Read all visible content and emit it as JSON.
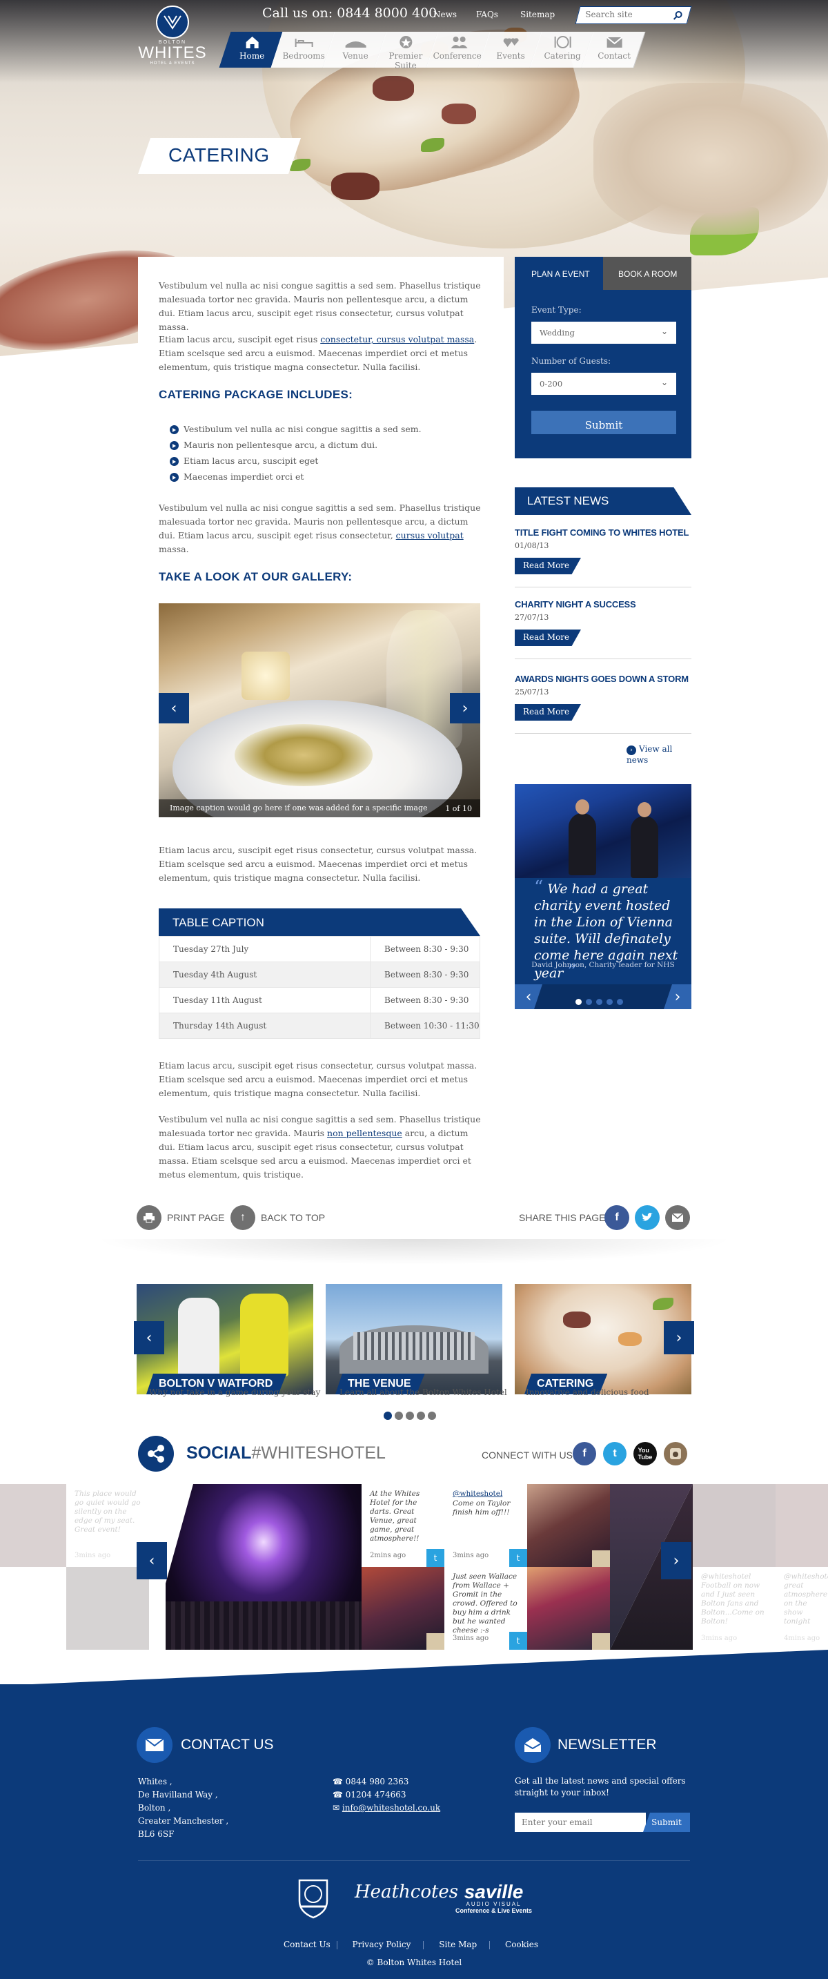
{
  "brand": {
    "small": "BOLTON",
    "name": "WHITES",
    "sub": "HOTEL & EVENTS"
  },
  "header": {
    "call_us": "Call us on: 0844 8000 400",
    "links": [
      "News",
      "FAQs",
      "Sitemap"
    ],
    "search_placeholder": "Search site"
  },
  "nav": [
    "Home",
    "Bedrooms",
    "Venue",
    "Premier Suite",
    "Conferences",
    "Events",
    "Catering",
    "Contact"
  ],
  "page_title": "CATERING",
  "main": {
    "p1": "Vestibulum vel nulla ac nisi congue sagittis a sed sem. Phasellus tristique malesuada tortor nec gravida. Mauris non pellentesque arcu, a dictum dui. Etiam lacus arcu, suscipit eget risus consectetur, cursus volutpat massa.",
    "p2_a": "Etiam lacus arcu, suscipit eget risus ",
    "p2_link": "consectetur, cursus volutpat massa",
    "p2_b": ". Etiam scelsque sed arcu a euismod. Maecenas imperdiet orci et metus elementum, quis tristique magna consectetur. Nulla facilisi.",
    "h_package": "CATERING PACKAGE INCLUDES:",
    "bullets": [
      "Vestibulum vel nulla ac nisi congue sagittis a sed sem.",
      "Mauris non pellentesque arcu, a dictum dui.",
      "Etiam lacus arcu, suscipit eget",
      "Maecenas imperdiet orci et"
    ],
    "p3_a": "Vestibulum vel nulla ac nisi congue sagittis a sed sem. Phasellus tristique malesuada tortor nec gravida. Mauris non pellentesque arcu, a dictum dui. Etiam lacus arcu, suscipit eget risus consectetur, ",
    "p3_link": "cursus volutpat",
    "p3_b": " massa.",
    "h_gallery": "TAKE A LOOK AT OUR GALLERY:",
    "gallery_caption": "Image caption would go here if one was added for a specific image",
    "gallery_count": "1 of 10",
    "p4": "Etiam lacus arcu, suscipit eget risus consectetur, cursus volutpat massa. Etiam scelsque sed arcu a euismod. Maecenas imperdiet orci et metus elementum, quis tristique magna consectetur. Nulla facilisi.",
    "table_caption": "TABLE CAPTION",
    "table_rows": [
      [
        "Tuesday 27th July",
        "Between 8:30 - 9:30"
      ],
      [
        "Tuesday 4th August",
        "Between 8:30 - 9:30"
      ],
      [
        "Tuesday 11th August",
        "Between 8:30 - 9:30"
      ],
      [
        "Thursday 14th August",
        "Between 10:30 - 11:30"
      ]
    ],
    "p5": "Etiam lacus arcu, suscipit eget risus consectetur, cursus volutpat massa. Etiam scelsque sed arcu a euismod. Maecenas imperdiet orci et metus elementum, quis tristique magna consectetur. Nulla facilisi.",
    "p6_a": "Vestibulum vel nulla ac nisi congue sagittis a sed sem. Phasellus tristique malesuada tortor nec gravida. Mauris ",
    "p6_link": "non pellentesque",
    "p6_b": " arcu, a dictum dui. Etiam lacus arcu, suscipit eget risus consectetur, cursus volutpat massa. Etiam scelsque sed arcu a euismod. Maecenas imperdiet orci et metus elementum, quis tristique."
  },
  "booking": {
    "tab_plan": "PLAN A EVENT",
    "tab_book": "BOOK A ROOM",
    "event_type_label": "Event Type:",
    "event_type_value": "Wedding",
    "guests_label": "Number of Guests:",
    "guests_value": "0-200",
    "submit": "Submit"
  },
  "news": {
    "heading": "LATEST NEWS",
    "items": [
      {
        "title": "TITLE FIGHT COMING TO WHITES HOTEL",
        "date": "01/08/13"
      },
      {
        "title": "CHARITY NIGHT A SUCCESS",
        "date": "27/07/13"
      },
      {
        "title": "AWARDS NIGHTS GOES DOWN A STORM",
        "date": "25/07/13"
      }
    ],
    "read_more": "Read More",
    "view_all": "View all news"
  },
  "testimonial": {
    "quote": "We had a great charity event hosted in the Lion of Vienna suite. Will definately come here again next year",
    "author": "David Johnson, Charity leader for NHS"
  },
  "page_actions": {
    "print": "PRINT PAGE",
    "top": "BACK TO TOP",
    "share": "SHARE THIS PAGE:"
  },
  "promo_cards": [
    {
      "label": "BOLTON V WATFORD",
      "sub": "Why not take in a game during your stay"
    },
    {
      "label": "THE VENUE",
      "sub": "Learn all about the Bolton Whites Hotel"
    },
    {
      "label": "CATERING",
      "sub": "Innovative and delicious food"
    }
  ],
  "social": {
    "title_bold": "SOCIAL",
    "title_hash": "#WHITESHOTEL",
    "connect": "CONNECT WITH US:",
    "tweets": [
      {
        "text": "At the Whites Hotel for the darts. Great Venue, great game, great atmosphere!!",
        "ago": "2mins ago"
      },
      {
        "handle": "@whiteshotel",
        "text": "Come on Taylor finish him off!!!",
        "ago": "3mins ago"
      },
      {
        "text": "Just seen Wallace from Wallace + Gromit in the crowd. Offered to buy him a drink but he wanted cheese :-s",
        "ago": "3mins ago"
      }
    ],
    "faded_tweets": [
      {
        "text": "This place would go quiet would go silently on the edge of my seat. Great event!",
        "ago": "3mins ago"
      },
      {
        "text": "@whiteshotel Football on now and I just seen Bolton fans and Bolton...Come on Bolton!",
        "ago": "3mins ago"
      },
      {
        "text": "@whiteshotel great atmosphere on the show tonight",
        "ago": "4mins ago"
      }
    ]
  },
  "footer": {
    "contact_title": "CONTACT US",
    "address": [
      "Whites ,",
      "De Havilland Way ,",
      "Bolton ,",
      "Greater Manchester ,",
      "BL6 6SF"
    ],
    "phone": "0844 980 2363",
    "fax": "01204 474663",
    "email": "info@whiteshotel.co.uk",
    "newsletter_title": "NEWSLETTER",
    "newsletter_text": "Get all the latest news and special offers straight to your inbox!",
    "email_placeholder": "Enter your email",
    "newsletter_submit": "Submit",
    "partner_heathcotes": "Heathcotes",
    "partner_saville_1": "saville",
    "partner_saville_2": "AUDIO VISUAL",
    "partner_saville_3": "Conference & Live Events",
    "links": [
      "Contact Us",
      "Privacy Policy",
      "Site Map",
      "Cookies"
    ],
    "copyright": "© Bolton Whites Hotel"
  },
  "colors": {
    "primary": "#0c3a7a",
    "accent": "#3c72b8",
    "facebook": "#3b5998",
    "twitter": "#2aa3e0",
    "grey": "#555555"
  }
}
